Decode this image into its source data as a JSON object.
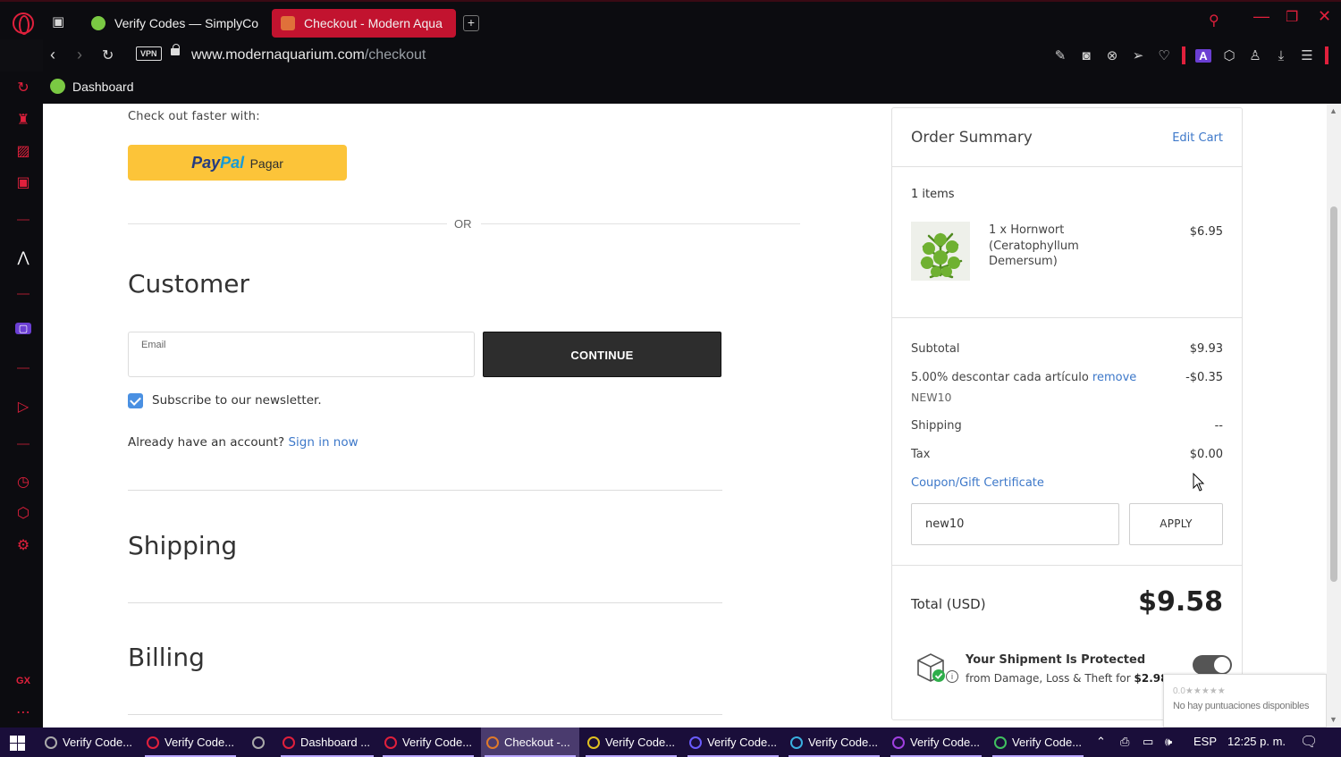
{
  "browser": {
    "tabs": [
      {
        "label": "Verify Codes — SimplyCo",
        "active": false
      },
      {
        "label": "Checkout - Modern Aqua",
        "active": true
      }
    ],
    "url_host": "www.modernaquarium.com",
    "url_path": "/checkout",
    "vpn_label": "VPN",
    "bookmark": "Dashboard",
    "sidebar_label": "GX"
  },
  "checkout": {
    "checkout_faster": "Check out faster with:",
    "paypal_pay": "Pay",
    "paypal_pal": "Pal",
    "paypal_pagar": "Pagar",
    "or": "OR",
    "customer_title": "Customer",
    "email_label": "Email",
    "continue": "CONTINUE",
    "newsletter": "Subscribe to our newsletter.",
    "newsletter_checked": true,
    "have_account": "Already have an account?",
    "sign_in": "Sign in now",
    "shipping_title": "Shipping",
    "billing_title": "Billing"
  },
  "summary": {
    "title": "Order Summary",
    "edit_cart": "Edit Cart",
    "items_count": "1 items",
    "item": {
      "name": "1 x Hornwort (Ceratophyllum Demersum)",
      "price": "$6.95"
    },
    "subtotal_label": "Subtotal",
    "subtotal_value": "$9.93",
    "discount_label": "5.00% descontar cada artículo",
    "discount_remove": "remove",
    "discount_value": "-$0.35",
    "discount_code": "NEW10",
    "shipping_label": "Shipping",
    "shipping_value": "--",
    "tax_label": "Tax",
    "tax_value": "$0.00",
    "coupon_link": "Coupon/Gift Certificate",
    "coupon_value": "new10",
    "apply": "APPLY",
    "total_label": "Total (USD)",
    "total_value": "$9.58",
    "protect_title": "Your Shipment Is Protected",
    "protect_sub": "from Damage, Loss & Theft for",
    "protect_price": "$2.98",
    "protect_enabled": true,
    "rating_stars": "0.0★★★★★",
    "rating_note": "No hay puntuaciones disponibles"
  },
  "taskbar": {
    "items": [
      "Verify Code...",
      "Verify Code...",
      "",
      "Dashboard ...",
      "Verify Code...",
      "Checkout -...",
      "Verify Code...",
      "Verify Code...",
      "Verify Code...",
      "Verify Code...",
      "Verify Code..."
    ],
    "language": "ESP",
    "time": "12:25 p. m."
  },
  "colors": {
    "opera_red": "#e0203c",
    "active_tab": "#c2132f",
    "link_blue": "#3d78c9",
    "paypal_yellow": "#fcc439",
    "taskbar": "#1a0e3a"
  }
}
